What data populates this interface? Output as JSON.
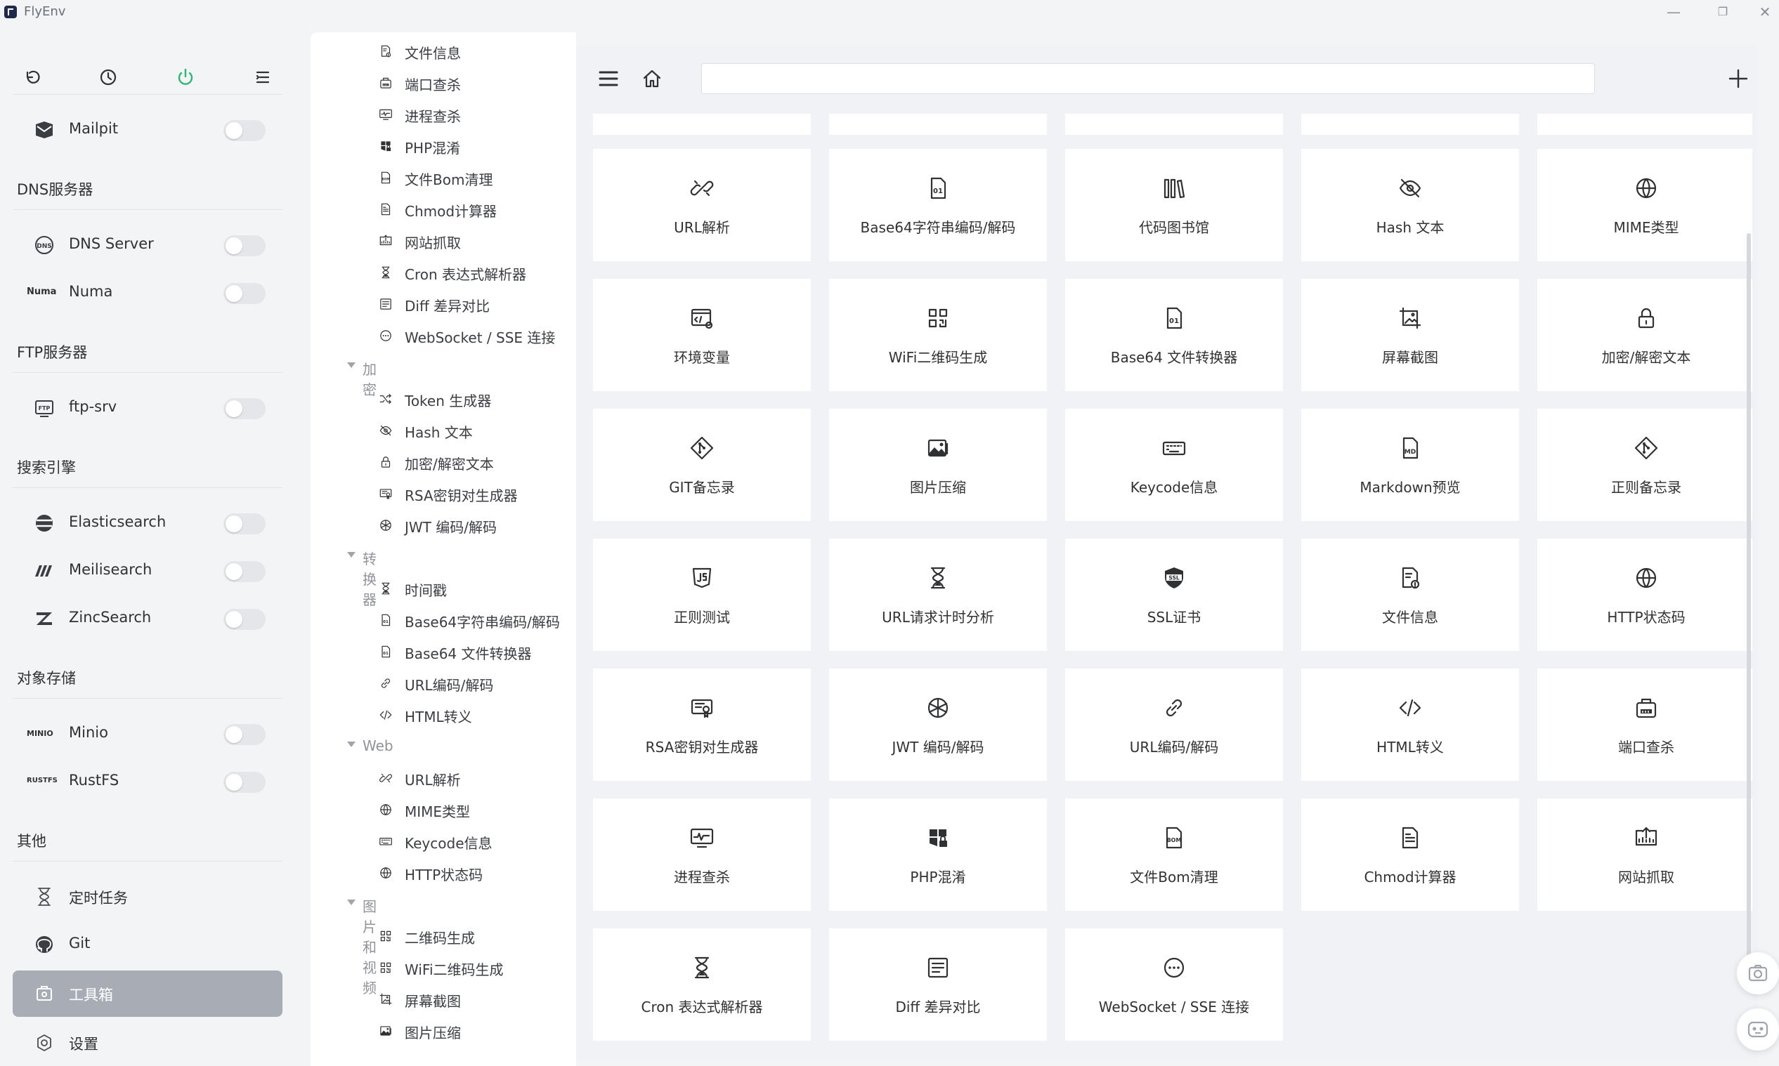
{
  "app": {
    "title": "FlyEnv"
  },
  "window": {
    "minimize": "—",
    "restore": "❐",
    "close": "✕"
  },
  "sidebar": {
    "top_icons": [
      "back-icon",
      "history-icon",
      "power-icon",
      "menu-list-icon"
    ],
    "items": [
      {
        "label": "Mailpit",
        "icon": "mail-icon",
        "toggle": false
      },
      {
        "group": "DNS服务器"
      },
      {
        "label": "DNS Server",
        "icon": "dns-icon",
        "toggle": false
      },
      {
        "label": "Numa",
        "logo": "Numa",
        "toggle": false
      },
      {
        "group": "FTP服务器"
      },
      {
        "label": "ftp-srv",
        "icon": "ftp-icon",
        "toggle": false
      },
      {
        "group": "搜索引擎"
      },
      {
        "label": "Elasticsearch",
        "icon": "elasticsearch-icon",
        "toggle": false
      },
      {
        "label": "Meilisearch",
        "icon": "meilisearch-icon",
        "toggle": false
      },
      {
        "label": "ZincSearch",
        "icon": "zincsearch-icon",
        "toggle": false
      },
      {
        "group": "对象存储"
      },
      {
        "label": "Minio",
        "logo": "MINIO",
        "toggle": false
      },
      {
        "label": "RustFS",
        "logo": "RUSTFS",
        "toggle": false
      },
      {
        "group": "其他"
      },
      {
        "label": "定时任务",
        "icon": "hourglass-icon"
      },
      {
        "label": "Git",
        "icon": "github-icon"
      },
      {
        "label": "工具箱",
        "icon": "toolbox-icon",
        "active": true
      },
      {
        "label": "设置",
        "icon": "settings-icon"
      }
    ]
  },
  "tree": {
    "items": [
      {
        "type": "item",
        "label": "文件信息",
        "icon": "file-info-icon"
      },
      {
        "type": "item",
        "label": "端口查杀",
        "icon": "port-icon"
      },
      {
        "type": "item",
        "label": "进程查杀",
        "icon": "process-icon"
      },
      {
        "type": "item",
        "label": "PHP混淆",
        "icon": "php-icon"
      },
      {
        "type": "item",
        "label": "文件Bom清理",
        "icon": "bom-icon"
      },
      {
        "type": "item",
        "label": "Chmod计算器",
        "icon": "chmod-icon"
      },
      {
        "type": "item",
        "label": "网站抓取",
        "icon": "crawl-icon"
      },
      {
        "type": "item",
        "label": "Cron 表达式解析器",
        "icon": "hourglass-icon"
      },
      {
        "type": "item",
        "label": "Diff 差异对比",
        "icon": "diff-icon"
      },
      {
        "type": "item",
        "label": "WebSocket / SSE 连接",
        "icon": "websocket-icon"
      },
      {
        "type": "cat",
        "label": "加密"
      },
      {
        "type": "item",
        "label": "Token 生成器",
        "icon": "shuffle-icon"
      },
      {
        "type": "item",
        "label": "Hash 文本",
        "icon": "eye-off-icon"
      },
      {
        "type": "item",
        "label": "加密/解密文本",
        "icon": "lock-icon"
      },
      {
        "type": "item",
        "label": "RSA密钥对生成器",
        "icon": "certificate-icon"
      },
      {
        "type": "item",
        "label": "JWT 编码/解码",
        "icon": "jwt-icon"
      },
      {
        "type": "cat",
        "label": "转换器"
      },
      {
        "type": "item",
        "label": "时间戳",
        "icon": "hourglass-icon"
      },
      {
        "type": "item",
        "label": "Base64字符串编码/解码",
        "icon": "base64-icon"
      },
      {
        "type": "item",
        "label": "Base64 文件转换器",
        "icon": "base64-icon"
      },
      {
        "type": "item",
        "label": "URL编码/解码",
        "icon": "link-icon"
      },
      {
        "type": "item",
        "label": "HTML转义",
        "icon": "code-icon"
      },
      {
        "type": "cat",
        "label": "Web"
      },
      {
        "type": "item",
        "label": "URL解析",
        "icon": "link-broken-icon"
      },
      {
        "type": "item",
        "label": "MIME类型",
        "icon": "globe-icon"
      },
      {
        "type": "item",
        "label": "Keycode信息",
        "icon": "keyboard-icon"
      },
      {
        "type": "item",
        "label": "HTTP状态码",
        "icon": "globe-icon"
      },
      {
        "type": "cat",
        "label": "图片和视频"
      },
      {
        "type": "item",
        "label": "二维码生成",
        "icon": "qrcode-icon"
      },
      {
        "type": "item",
        "label": "WiFi二维码生成",
        "icon": "qrcode-icon"
      },
      {
        "type": "item",
        "label": "屏幕截图",
        "icon": "screenshot-icon"
      },
      {
        "type": "item",
        "label": "图片压缩",
        "icon": "image-icon"
      }
    ]
  },
  "main": {
    "search": {
      "value": "",
      "placeholder": ""
    },
    "cards": [
      {
        "label": "URL解析",
        "icon": "link-broken-icon"
      },
      {
        "label": "Base64字符串编码/解码",
        "icon": "base64-icon"
      },
      {
        "label": "代码图书馆",
        "icon": "library-icon"
      },
      {
        "label": "Hash 文本",
        "icon": "eye-off-icon"
      },
      {
        "label": "MIME类型",
        "icon": "globe-icon"
      },
      {
        "label": "环境变量",
        "icon": "env-icon"
      },
      {
        "label": "WiFi二维码生成",
        "icon": "qrcode-icon"
      },
      {
        "label": "Base64 文件转换器",
        "icon": "base64-icon"
      },
      {
        "label": "屏幕截图",
        "icon": "screenshot-icon"
      },
      {
        "label": "加密/解密文本",
        "icon": "lock-icon"
      },
      {
        "label": "GIT备忘录",
        "icon": "git-icon"
      },
      {
        "label": "图片压缩",
        "icon": "image-icon"
      },
      {
        "label": "Keycode信息",
        "icon": "keyboard-icon"
      },
      {
        "label": "Markdown预览",
        "icon": "markdown-icon"
      },
      {
        "label": "正则备忘录",
        "icon": "git-icon"
      },
      {
        "label": "正则测试",
        "icon": "js-icon"
      },
      {
        "label": "URL请求计时分析",
        "icon": "hourglass-icon"
      },
      {
        "label": "SSL证书",
        "icon": "ssl-icon"
      },
      {
        "label": "文件信息",
        "icon": "file-info-icon"
      },
      {
        "label": "HTTP状态码",
        "icon": "globe-icon"
      },
      {
        "label": "RSA密钥对生成器",
        "icon": "certificate-icon"
      },
      {
        "label": "JWT 编码/解码",
        "icon": "jwt-icon"
      },
      {
        "label": "URL编码/解码",
        "icon": "link-icon"
      },
      {
        "label": "HTML转义",
        "icon": "code-icon"
      },
      {
        "label": "端口查杀",
        "icon": "port-icon"
      },
      {
        "label": "进程查杀",
        "icon": "process-icon"
      },
      {
        "label": "PHP混淆",
        "icon": "php-icon"
      },
      {
        "label": "文件Bom清理",
        "icon": "bom-icon"
      },
      {
        "label": "Chmod计算器",
        "icon": "chmod-icon"
      },
      {
        "label": "网站抓取",
        "icon": "crawl-icon"
      },
      {
        "label": "Cron 表达式解析器",
        "icon": "hourglass-icon"
      },
      {
        "label": "Diff 差异对比",
        "icon": "diff-icon"
      },
      {
        "label": "WebSocket / SSE 连接",
        "icon": "websocket-icon"
      }
    ]
  },
  "colors": {
    "active_item_bg": "#a8adb5",
    "power_icon": "#2bb673",
    "page_bg": "#f3f4f6",
    "card_bg": "#ffffff"
  }
}
